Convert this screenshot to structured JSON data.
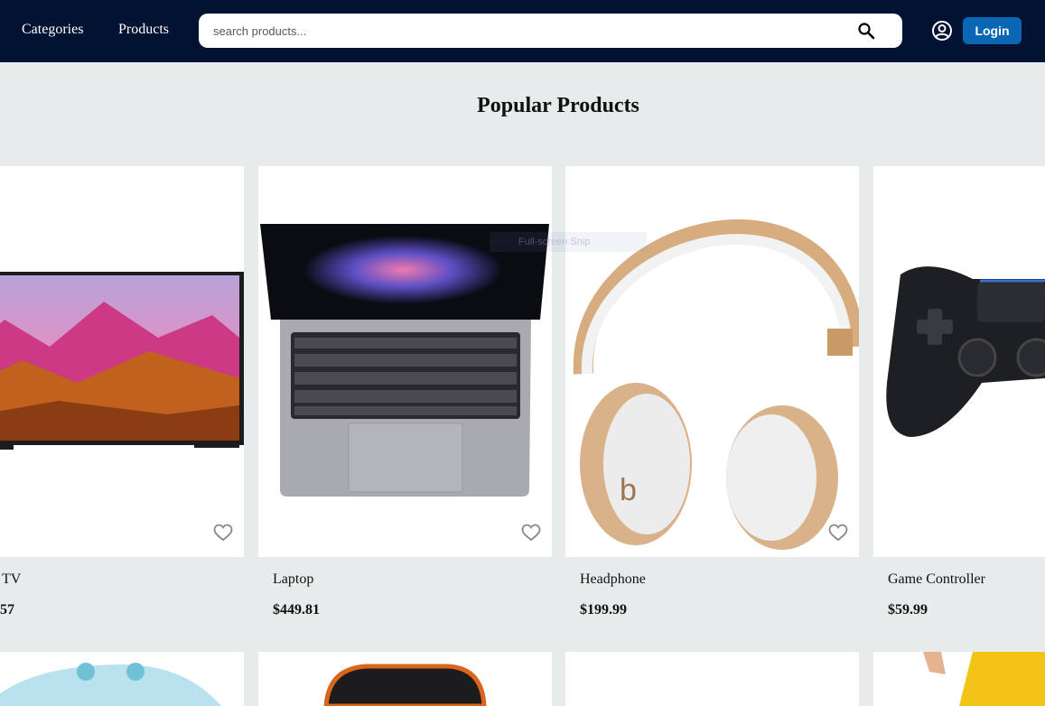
{
  "nav": {
    "categories": "Categories",
    "products": "Products"
  },
  "search": {
    "placeholder": "search products...",
    "value": ""
  },
  "login_label": "Login",
  "section_title": "Popular Products",
  "products": [
    {
      "name": "TV",
      "price": "57"
    },
    {
      "name": "Laptop",
      "price": "$449.81"
    },
    {
      "name": "Headphone",
      "price": "$199.99"
    },
    {
      "name": "Game Controller",
      "price": "$59.99"
    }
  ],
  "overlay_text": "Full-screen Snip",
  "colors": {
    "navbar": "#021232",
    "accent": "#0a67b3",
    "page_bg": "#e7ebeb"
  },
  "icons": [
    "search-icon",
    "account-icon",
    "heart-icon"
  ]
}
